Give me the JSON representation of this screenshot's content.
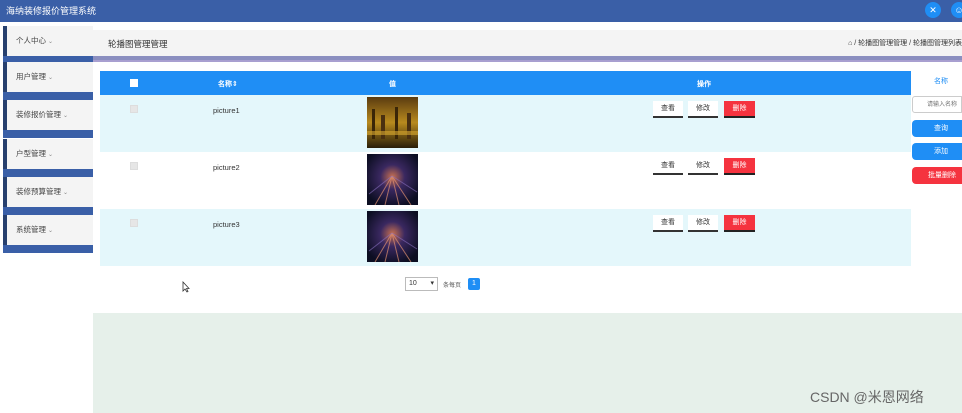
{
  "header": {
    "title": "海纳装修报价管理系统"
  },
  "sidebar": {
    "items": [
      {
        "label": "个人中心"
      },
      {
        "label": "用户管理"
      },
      {
        "label": "装修报价管理"
      },
      {
        "label": "户型管理"
      },
      {
        "label": "装修预算管理"
      },
      {
        "label": "系统管理"
      }
    ]
  },
  "page": {
    "title": "轮播图管理管理",
    "breadcrumb": "/ 轮播图管理管理 / 轮播图管理列表"
  },
  "table": {
    "columns": {
      "name": "名称⇕",
      "value": "值",
      "actions": "操作"
    },
    "rows": [
      {
        "name": "picture1"
      },
      {
        "name": "picture2"
      },
      {
        "name": "picture3"
      }
    ],
    "actions": {
      "view": "查看",
      "edit": "修改",
      "delete": "删除"
    }
  },
  "pagination": {
    "page_size": "10",
    "per_page_label": "条每页",
    "current_page": "1"
  },
  "search": {
    "label": "名称",
    "placeholder": "请输入名称",
    "query": "查询",
    "add": "添加",
    "batch_delete": "批量删除"
  },
  "watermark": "CSDN @米恩网络",
  "colors": {
    "header": "#3a5fa7",
    "primary": "#1f8ef5",
    "danger": "#f5333f",
    "row_alt": "#e4f7fb"
  }
}
